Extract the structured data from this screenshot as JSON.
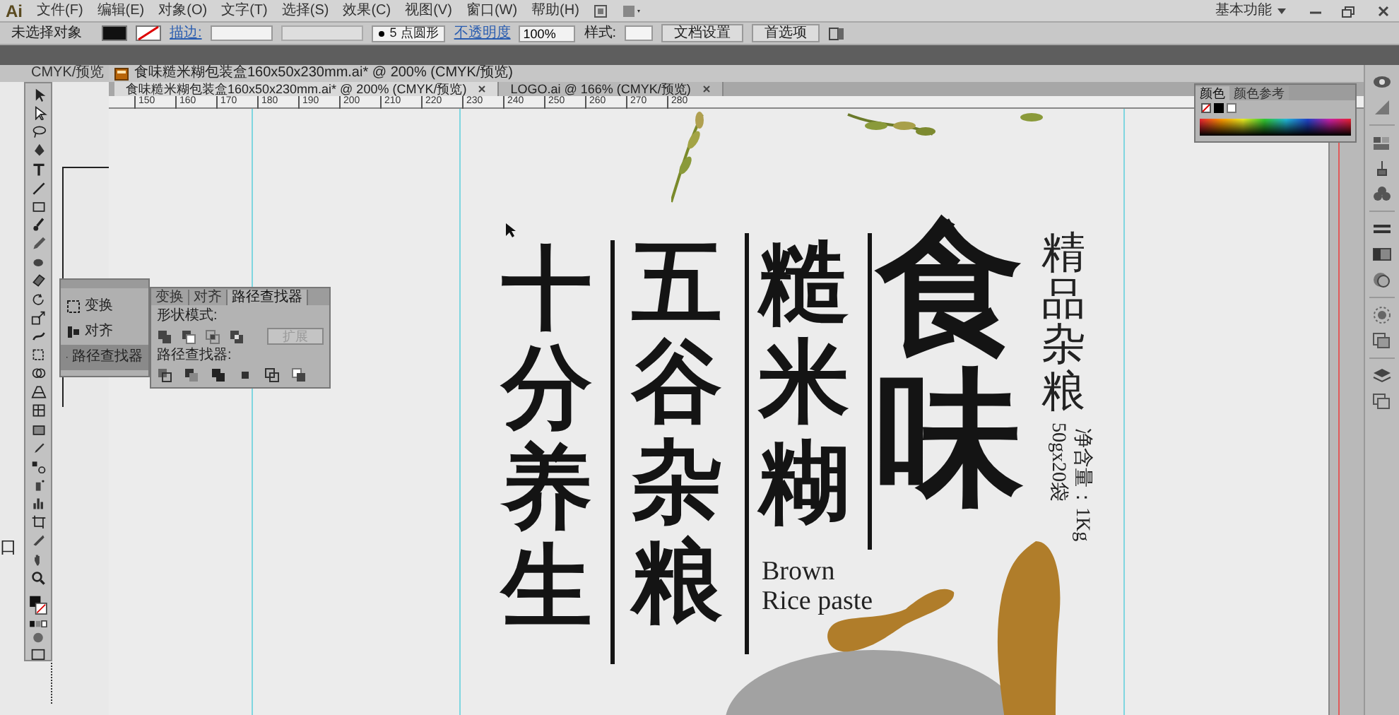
{
  "menu_bar": {
    "logo": "Ai",
    "menus": [
      "文件(F)",
      "编辑(E)",
      "对象(O)",
      "文字(T)",
      "选择(S)",
      "效果(C)",
      "视图(V)",
      "窗口(W)",
      "帮助(H)"
    ],
    "workspace": "基本功能"
  },
  "control_bar": {
    "selection": "未选择对象",
    "stroke_label": "描边:",
    "brush": "5 点圆形",
    "opacity_label": "不透明度",
    "opacity": "100%",
    "style_label": "样式:",
    "buttons": [
      "文档设置",
      "首选项"
    ]
  },
  "background_document": {
    "tab": "CMYK/预览"
  },
  "document_window": {
    "title": "食味糙米糊包装盒160x50x230mm.ai* @ 200% (CMYK/预览)"
  },
  "doc_tabs": [
    {
      "label": "食味糙米糊包装盒160x50x230mm.ai* @ 200% (CMYK/预览)",
      "selected": true
    },
    {
      "label": "LOGO.ai @ 166% (CMYK/预览)",
      "selected": false
    }
  ],
  "ruler": [
    "150",
    "160",
    "170",
    "180",
    "190",
    "200",
    "210",
    "220",
    "230",
    "240",
    "250",
    "260",
    "270",
    "280"
  ],
  "panel_dock": [
    {
      "label": "变换",
      "selected": false
    },
    {
      "label": "对齐",
      "selected": false
    },
    {
      "label": "路径查找器",
      "selected": true
    }
  ],
  "pathfinder_panel": {
    "tabs": [
      {
        "label": "变换",
        "selected": false
      },
      {
        "label": "对齐",
        "selected": false
      },
      {
        "label": "路径查找器",
        "selected": true
      }
    ],
    "shape_modes_label": "形状模式:",
    "expand_button": {
      "label": "扩展",
      "disabled": true
    },
    "pathfinders_label": "路径查找器:"
  },
  "color_panel": {
    "tabs": [
      {
        "label": "颜色",
        "selected": true
      },
      {
        "label": "颜色参考",
        "selected": false
      }
    ]
  },
  "artwork": {
    "columns": [
      "十分养生",
      "五谷杂粮",
      "糙米糊"
    ],
    "title": "食味",
    "subtitle": "精品杂粮",
    "net_weight": "净含量：1Kg",
    "packs": "50gx20袋",
    "english": [
      "Brown",
      "Rice paste"
    ]
  },
  "edge_text": "口"
}
